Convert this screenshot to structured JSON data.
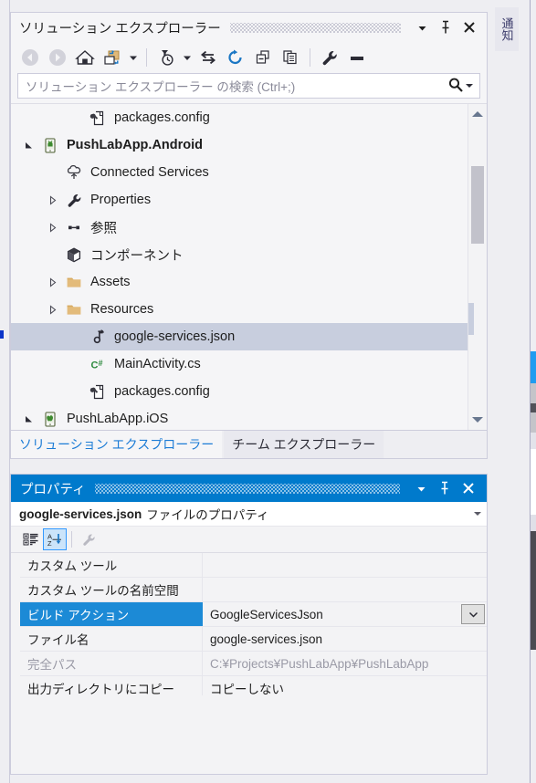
{
  "solution_explorer": {
    "title": "ソリューション エクスプローラー",
    "titlebar_buttons": [
      {
        "name": "window-menu-dropdown",
        "icon": "chevron-down-icon"
      },
      {
        "name": "auto-hide-pin",
        "icon": "pin-icon"
      },
      {
        "name": "close-window",
        "icon": "close-icon"
      }
    ],
    "toolbar": [
      {
        "name": "back-button",
        "icon": "back-arrow-icon",
        "enabled": false
      },
      {
        "name": "forward-button",
        "icon": "forward-arrow-icon",
        "enabled": false
      },
      {
        "name": "home-button",
        "icon": "home-icon",
        "enabled": true
      },
      {
        "name": "solution-view-button",
        "icon": "solution-switch-icon",
        "enabled": true
      },
      {
        "name": "solution-view-dropdown",
        "icon": "chevron-down-icon",
        "enabled": true
      },
      {
        "name": "pending-changes-filter",
        "icon": "clock-filter-icon",
        "enabled": true
      },
      {
        "name": "pending-changes-dropdown",
        "icon": "chevron-down-icon",
        "enabled": true
      },
      {
        "name": "sync-with-active-document",
        "icon": "sync-arrows-icon",
        "enabled": true
      },
      {
        "name": "refresh-button",
        "icon": "refresh-icon",
        "enabled": true
      },
      {
        "name": "collapse-all-button",
        "icon": "collapse-all-icon",
        "enabled": true
      },
      {
        "name": "show-all-files-button",
        "icon": "show-all-files-icon",
        "enabled": true
      },
      {
        "name": "properties-button",
        "icon": "wrench-icon",
        "enabled": true
      },
      {
        "name": "preview-selected-items",
        "icon": "preview-icon",
        "enabled": true
      }
    ],
    "search": {
      "placeholder": "ソリューション エクスプローラー の検索 (Ctrl+;)",
      "value": "",
      "icon": "search-magnifier-icon",
      "dropdown_icon": "chevron-down-icon"
    },
    "tree": [
      {
        "label": "packages.config",
        "icon": "config-file-icon",
        "indent": 3,
        "expander": "none",
        "bold": false,
        "selected": false
      },
      {
        "label": "PushLabApp.Android",
        "icon": "android-project-icon",
        "indent": 1,
        "expander": "expanded",
        "bold": true,
        "selected": false
      },
      {
        "label": "Connected Services",
        "icon": "connected-services-icon",
        "indent": 2,
        "expander": "none",
        "bold": false,
        "selected": false
      },
      {
        "label": "Properties",
        "icon": "wrench-icon",
        "indent": 2,
        "expander": "collapsed",
        "bold": false,
        "selected": false
      },
      {
        "label": "参照",
        "icon": "references-icon",
        "indent": 2,
        "expander": "collapsed",
        "bold": false,
        "selected": false
      },
      {
        "label": "コンポーネント",
        "icon": "component-cube-icon",
        "indent": 2,
        "expander": "none",
        "bold": false,
        "selected": false
      },
      {
        "label": "Assets",
        "icon": "folder-icon",
        "indent": 2,
        "expander": "collapsed",
        "bold": false,
        "selected": false
      },
      {
        "label": "Resources",
        "icon": "folder-icon",
        "indent": 2,
        "expander": "collapsed",
        "bold": false,
        "selected": false
      },
      {
        "label": "google-services.json",
        "icon": "json-file-icon",
        "indent": 3,
        "expander": "none",
        "bold": false,
        "selected": true
      },
      {
        "label": "MainActivity.cs",
        "icon": "csharp-file-icon",
        "indent": 3,
        "expander": "none",
        "bold": false,
        "selected": false
      },
      {
        "label": "packages.config",
        "icon": "config-file-icon",
        "indent": 3,
        "expander": "none",
        "bold": false,
        "selected": false
      },
      {
        "label": "PushLabApp.iOS",
        "icon": "ios-project-icon",
        "indent": 1,
        "expander": "expanded",
        "bold": false,
        "selected": false
      }
    ],
    "scrollbar": {
      "up_arrow": "scroll-up-arrow-icon",
      "down_arrow": "scroll-down-arrow-icon"
    },
    "tabs": [
      {
        "label": "ソリューション エクスプローラー",
        "active": true
      },
      {
        "label": "チーム エクスプローラー",
        "active": false
      }
    ]
  },
  "properties": {
    "title": "プロパティ",
    "titlebar_buttons": [
      {
        "name": "window-menu-dropdown",
        "icon": "chevron-down-icon"
      },
      {
        "name": "auto-hide-pin",
        "icon": "pin-icon"
      },
      {
        "name": "close-window",
        "icon": "close-icon"
      }
    ],
    "object": {
      "name": "google-services.json",
      "suffix": "ファイルのプロパティ",
      "dropdown_icon": "chevron-down-icon"
    },
    "toolbar": [
      {
        "name": "categorized-view-button",
        "icon": "categorized-icon",
        "active": false
      },
      {
        "name": "alphabetical-view-button",
        "icon": "alphabetical-sort-icon",
        "active": true
      },
      {
        "name": "property-pages-button",
        "icon": "wrench-icon",
        "active": false
      }
    ],
    "rows": [
      {
        "name": "カスタム ツール",
        "value": "",
        "selected": false,
        "dim": false,
        "dropdown": false
      },
      {
        "name": "カスタム ツールの名前空間",
        "value": "",
        "selected": false,
        "dim": false,
        "dropdown": false
      },
      {
        "name": "ビルド アクション",
        "value": "GoogleServicesJson",
        "selected": true,
        "dim": false,
        "dropdown": true
      },
      {
        "name": "ファイル名",
        "value": "google-services.json",
        "selected": false,
        "dim": false,
        "dropdown": false
      },
      {
        "name": "完全パス",
        "value": "C:¥Projects¥PushLabApp¥PushLabApp",
        "selected": false,
        "dim": true,
        "dropdown": false
      },
      {
        "name": "出力ディレクトリにコピー",
        "value": "コピーしない",
        "selected": false,
        "dim": false,
        "dropdown": false
      }
    ]
  },
  "right_strip": {
    "notification_tab_label": "通知"
  },
  "colors": {
    "properties_titlebar": "#007acc",
    "row_selected": "#1c8ad6",
    "tree_selected": "#c8cede",
    "active_tab_text": "#1c7cd6",
    "window_bg": "#eeeef2",
    "panel_bg": "#f5f5f7"
  }
}
